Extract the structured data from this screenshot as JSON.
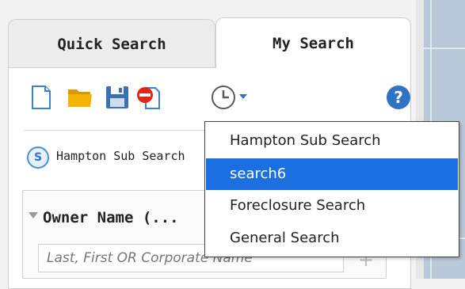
{
  "tabs": [
    {
      "label": "Quick Search",
      "active": false
    },
    {
      "label": "My Search",
      "active": true
    }
  ],
  "toolbar": {
    "icons": [
      "new-document-icon",
      "open-folder-icon",
      "save-icon",
      "delete-search-icon",
      "history-clock-icon",
      "dropdown-arrow-icon",
      "help-icon"
    ],
    "help_symbol": "?"
  },
  "saved_search": {
    "badge": "S",
    "label": "Hampton Sub Search"
  },
  "owner_section": {
    "title": "Owner Name (...",
    "input_placeholder": "Last, First OR Corporate Name",
    "add_symbol": "+"
  },
  "history_menu": {
    "items": [
      "Hampton Sub Search",
      "search6",
      "Foreclosure Search",
      "General Search"
    ],
    "selected_index": 1
  },
  "colors": {
    "accent": "#1c6fe0",
    "folder": "#f2b400",
    "save": "#3d6fb3",
    "delete": "#e1251b",
    "help": "#2f74c4"
  }
}
